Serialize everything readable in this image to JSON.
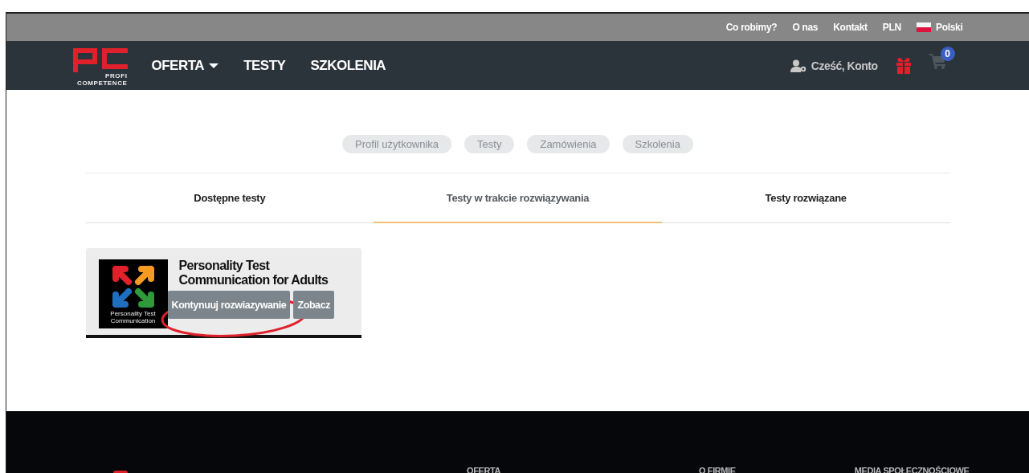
{
  "top_bar": {
    "links": [
      "Co robimy?",
      "O nas",
      "Kontakt",
      "PLN"
    ],
    "language": "Polski"
  },
  "nav": {
    "logo_text": "PROFI",
    "logo_subtext": "COMPETENCE",
    "links": [
      {
        "label": "OFERTA",
        "dropdown": true
      },
      {
        "label": "TESTY",
        "dropdown": false
      },
      {
        "label": "SZKOLENIA",
        "dropdown": false
      }
    ],
    "account": "Cześć, Konto",
    "cart_count": "0"
  },
  "profile_tabs": [
    {
      "label": "Profil użytkownika",
      "selected": false
    },
    {
      "label": "Testy",
      "selected": false
    },
    {
      "label": "Zamówienia",
      "selected": false
    },
    {
      "label": "Szkolenia",
      "selected": false
    }
  ],
  "test_tabs": [
    {
      "label": "Dostępne testy",
      "selected": false
    },
    {
      "label": "Testy w trakcie rozwiązywania",
      "selected": true
    },
    {
      "label": "Testy rozwiązane",
      "selected": false
    }
  ],
  "cards": [
    {
      "image_caption": "Personality Test Communication",
      "title": "Personality Test Communication for Adults",
      "buttons": [
        "Kontynuuj rozwiazywanie",
        "Zobacz"
      ],
      "highlighted": true
    }
  ],
  "footer": {
    "headings": [
      "OFERTA",
      "O FIRMIE",
      "MEDIA SPOŁECZNOŚCIOWE"
    ]
  }
}
